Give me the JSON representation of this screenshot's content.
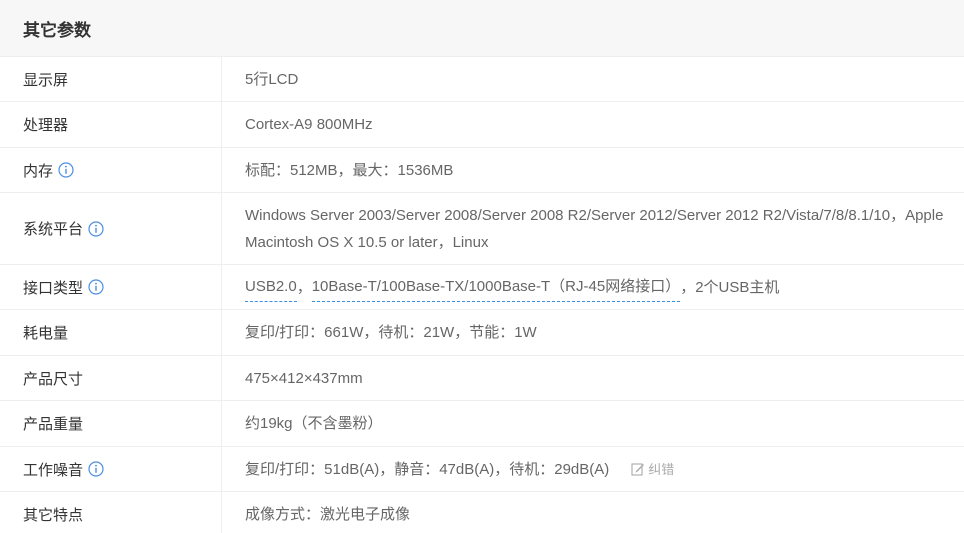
{
  "section": {
    "title": "其它参数"
  },
  "rows": [
    {
      "label": "显示屏",
      "value": "5行LCD"
    },
    {
      "label": "处理器",
      "value": "Cortex-A9 800MHz"
    },
    {
      "label": "内存",
      "value": "标配：512MB，最大：1536MB"
    },
    {
      "label": "系统平台",
      "value": "Windows Server 2003/Server 2008/Server 2008 R2/Server 2012/Server 2012 R2/Vista/7/8/8.1/10，Apple Macintosh OS X 10.5 or later，Linux"
    },
    {
      "label": "接口类型",
      "link1": "USB2.0",
      "sep": "，",
      "link2": "10Base-T/100Base-TX/1000Base-T（RJ-45网络接口）",
      "rest": "，2个USB主机"
    },
    {
      "label": "耗电量",
      "value": "复印/打印：661W，待机：21W，节能：1W"
    },
    {
      "label": "产品尺寸",
      "value": "475×412×437mm"
    },
    {
      "label": "产品重量",
      "value": "约19kg（不含墨粉）"
    },
    {
      "label": "工作噪音",
      "value": "复印/打印：51dB(A)，静音：47dB(A)，待机：29dB(A)",
      "correct_label": "纠错"
    },
    {
      "label": "其它特点",
      "value": "成像方式：激光电子成像"
    }
  ],
  "icons": {
    "info": "info-circle-icon",
    "correct": "edit-icon"
  },
  "colors": {
    "info_icon": "#4a90e2",
    "link_underline": "#3a8ee6",
    "header_bg": "#f7f7f7",
    "border": "#eeeeee"
  }
}
